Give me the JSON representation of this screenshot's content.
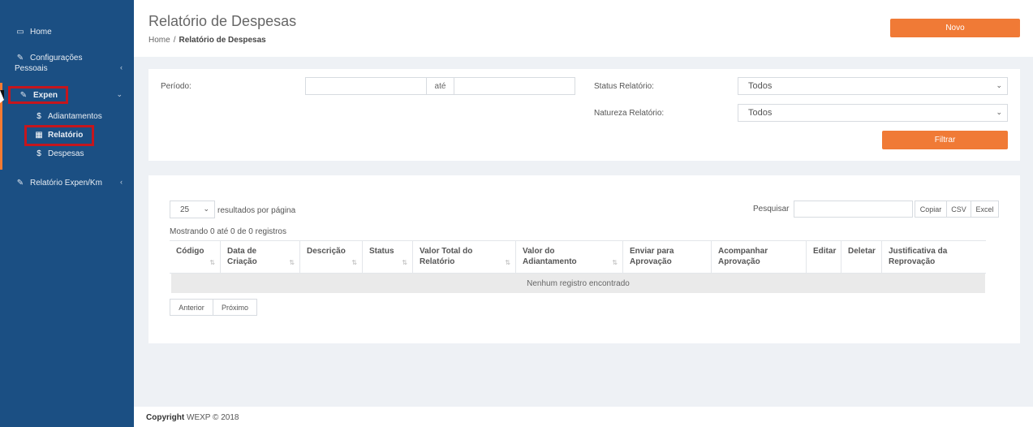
{
  "sidebar": {
    "items": [
      {
        "label": "Home",
        "icon": "monitor-icon"
      },
      {
        "label": "Configurações Pessoais",
        "icon": "edit-icon"
      },
      {
        "label": "Expen",
        "icon": "edit-icon"
      },
      {
        "label": "Relatório Expen/Km",
        "icon": "edit-icon"
      }
    ],
    "sub_items": [
      {
        "label": "Adiantamentos",
        "icon": "dollar-icon"
      },
      {
        "label": "Relatório",
        "icon": "table-icon"
      },
      {
        "label": "Despesas",
        "icon": "dollar-icon"
      }
    ],
    "icons": {
      "monitor": "▭",
      "edit": "✎",
      "dollar": "$",
      "table": "▦",
      "chevron_left": "‹",
      "chevron_down": "⌄"
    }
  },
  "header": {
    "title": "Relatório de Despesas",
    "breadcrumb": {
      "home": "Home",
      "separator": "/",
      "current": "Relatório de Despesas"
    },
    "new_button": "Novo"
  },
  "filters": {
    "period_label": "Período:",
    "period_from": "",
    "period_to": "",
    "period_separator": "até",
    "status_label": "Status Relatório:",
    "status_value": "Todos",
    "nature_label": "Natureza Relatório:",
    "nature_value": "Todos",
    "filter_button": "Filtrar"
  },
  "table": {
    "page_size": "25",
    "page_size_suffix": "resultados por página",
    "search_label": "Pesquisar",
    "search_value": "",
    "export_buttons": [
      "Copiar",
      "CSV",
      "Excel"
    ],
    "info": "Mostrando 0 até 0 de 0 registros",
    "columns": [
      "Código",
      "Data de Criação",
      "Descrição",
      "Status",
      "Valor Total do Relatório",
      "Valor do Adiantamento",
      "Enviar para Aprovação",
      "Acompanhar Aprovação",
      "Editar",
      "Deletar",
      "Justificativa da Reprovação"
    ],
    "empty_message": "Nenhum registro encontrado",
    "prev_button": "Anterior",
    "next_button": "Próximo"
  },
  "footer": {
    "brand": "Copyright",
    "text": "WEXP © 2018"
  },
  "colors": {
    "sidebar": "#1b4f83",
    "accent": "#f07a36",
    "highlight": "#c5161d"
  }
}
